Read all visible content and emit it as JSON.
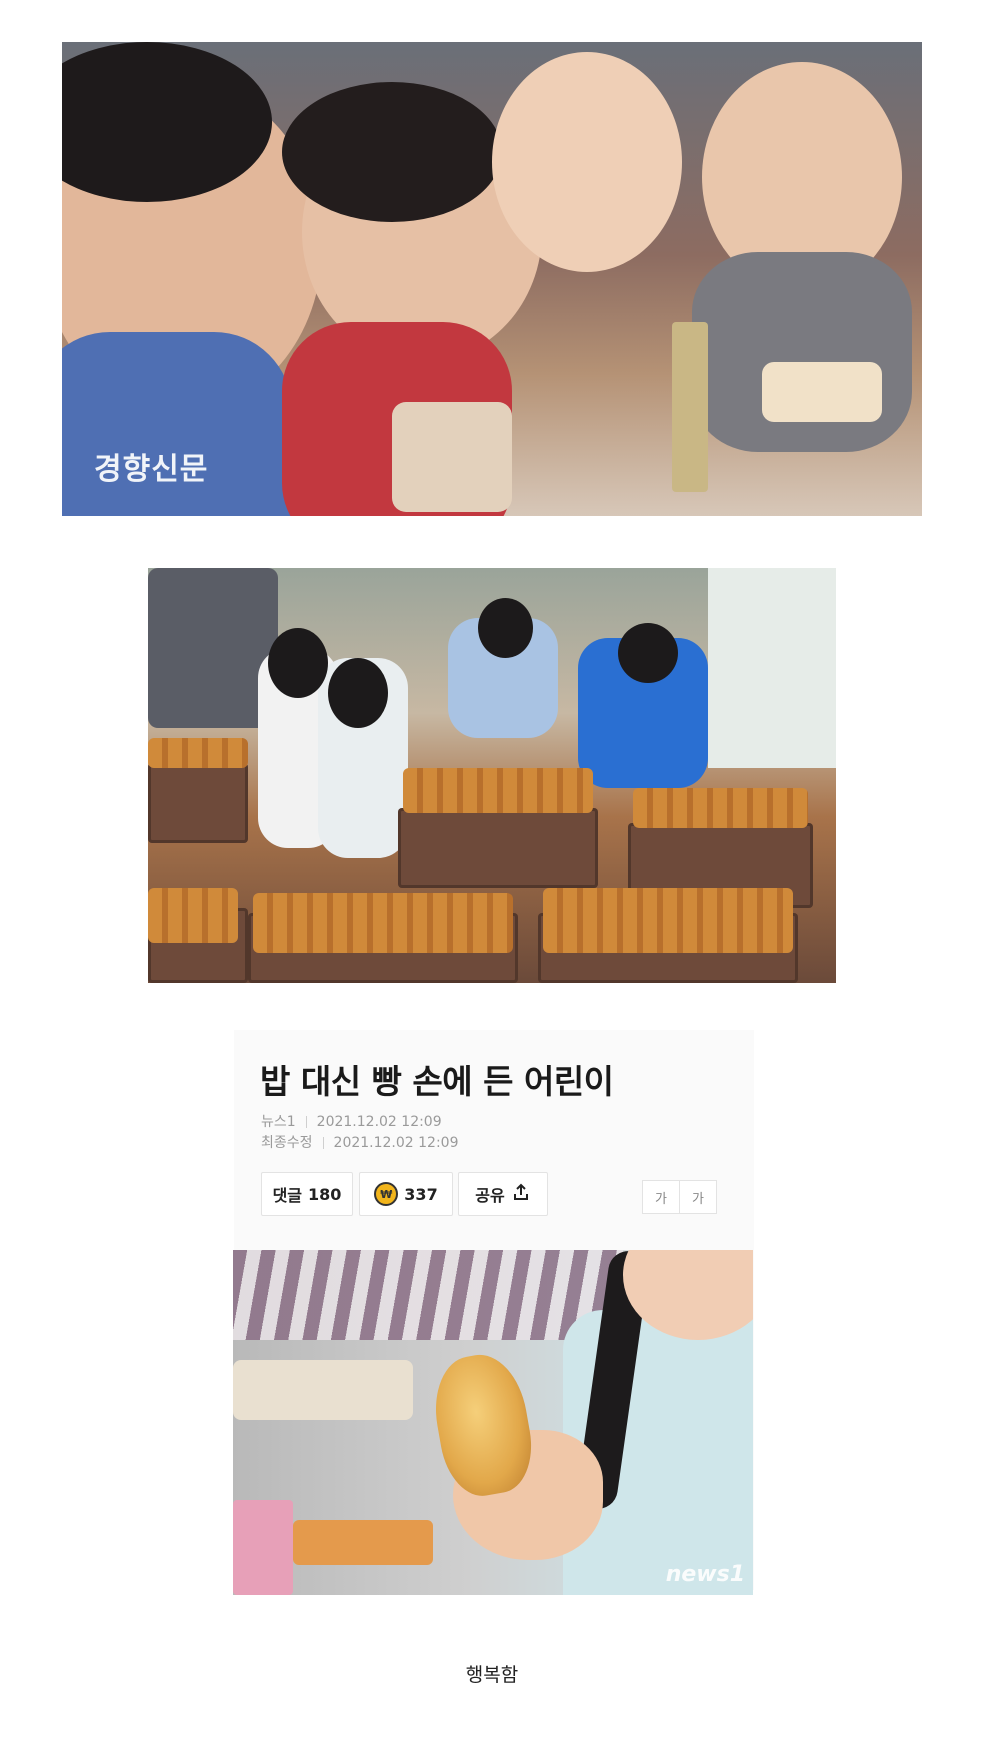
{
  "photo1": {
    "watermark": "경향신문"
  },
  "article": {
    "headline": "밥 대신 빵 손에 든 어린이",
    "source": "뉴스1",
    "published": "2021.12.02 12:09",
    "modified_label": "최종수정",
    "modified": "2021.12.02 12:09",
    "comments_label": "댓글",
    "comments_count": "180",
    "reaction_count": "337",
    "share_label": "공유",
    "font_small": "가",
    "font_large": "가",
    "photo_logo": "news1"
  },
  "caption": "행복함",
  "icons": [
    "coin-reaction-icon",
    "share-upload-icon"
  ]
}
